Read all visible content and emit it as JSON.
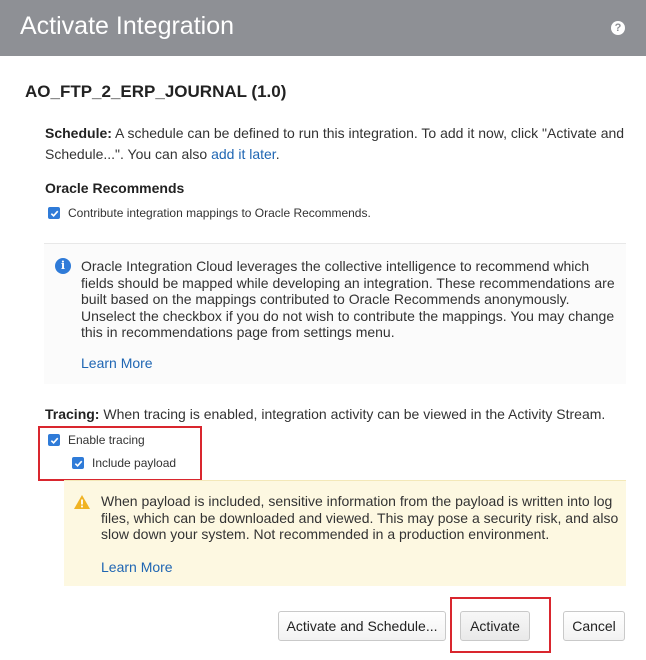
{
  "dialog": {
    "title": "Activate Integration",
    "help_icon_glyph": "?"
  },
  "integration": {
    "name": "AO_FTP_2_ERP_JOURNAL (1.0)"
  },
  "schedule": {
    "label": "Schedule:",
    "text": " A schedule can be defined to run this integration. To add it now, click \"Activate and Schedule...\". You can also ",
    "link": "add it later",
    "text_end": "."
  },
  "recommends": {
    "heading": "Oracle Recommends",
    "checkbox_label": "Contribute integration mappings to Oracle Recommends.",
    "checked": true,
    "info_text": "Oracle Integration Cloud leverages the collective intelligence to recommend which fields should be mapped while developing an integration. These recommendations are built based on the mappings contributed to Oracle Recommends anonymously. Unselect the checkbox if you do not wish to contribute the mappings. You may change this in recommendations page from settings menu.",
    "learn_more": "Learn More"
  },
  "tracing": {
    "label": "Tracing:",
    "text": " When tracing is enabled, integration activity can be viewed in the Activity Stream.",
    "enable_label": "Enable tracing",
    "enable_checked": true,
    "payload_label": "Include payload",
    "payload_checked": true,
    "warning_text": "When payload is included, sensitive information from the payload is written into log files, which can be downloaded and viewed. This may pose a security risk, and also slow down your system. Not recommended in a production environment.",
    "learn_more": "Learn More"
  },
  "buttons": {
    "activate_schedule": "Activate and Schedule...",
    "activate": "Activate",
    "cancel": "Cancel"
  },
  "colors": {
    "header_bg": "#8e9095",
    "link": "#1f66b3",
    "checkbox": "#2f7bd8",
    "highlight": "#d9262e",
    "warning_bg": "#fdf8e1",
    "warning_icon": "#f0b323"
  },
  "icons": {
    "help": "help-icon",
    "info": "info-icon",
    "warning": "warning-icon",
    "checkmark": "checkmark-icon"
  }
}
